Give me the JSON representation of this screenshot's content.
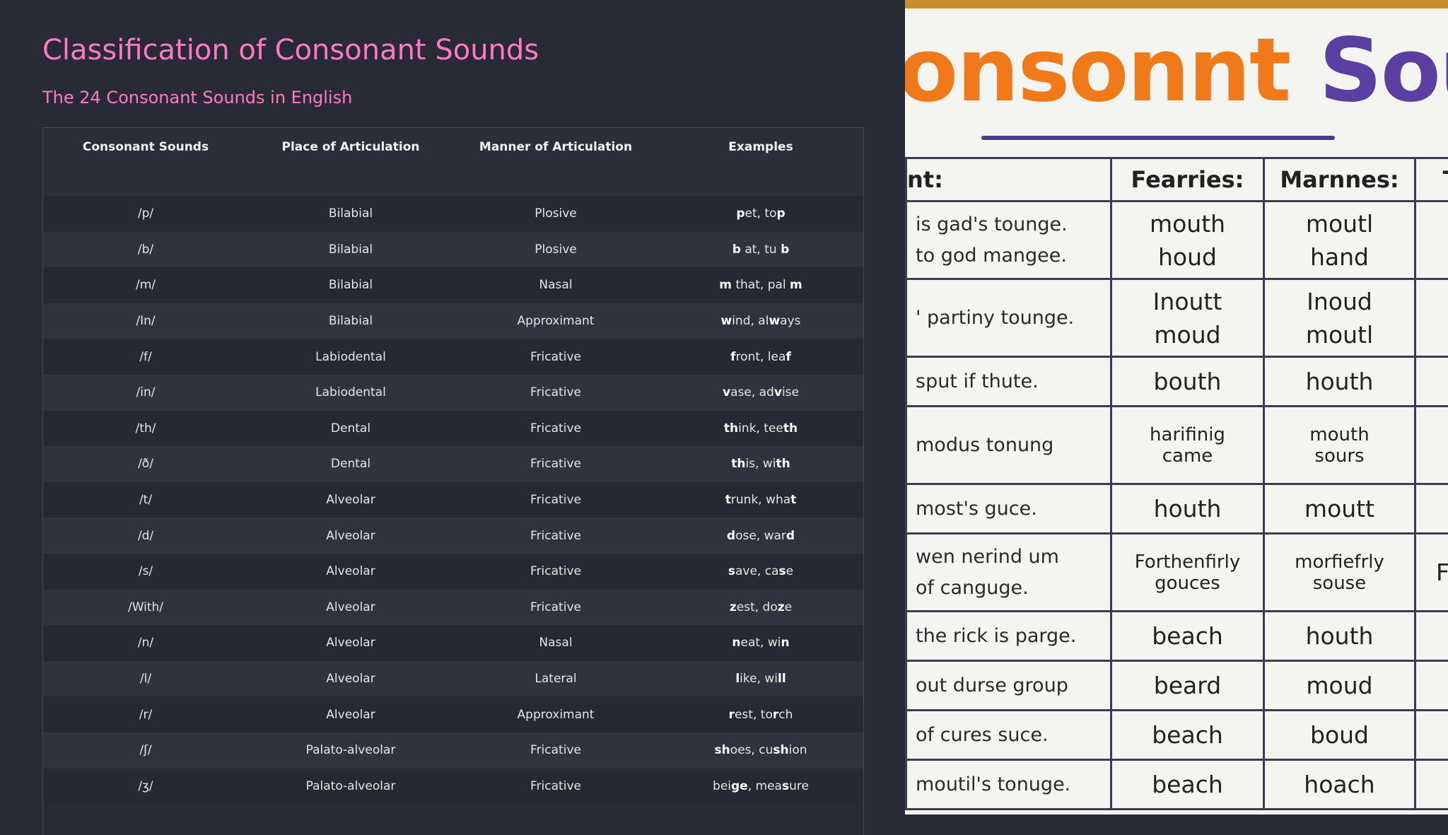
{
  "page": {
    "title": "Classification of Consonant Sounds",
    "subtitle": "The 24 Consonant Sounds in English"
  },
  "table": {
    "headers": [
      "Consonant Sounds",
      "Place of Articulation",
      "Manner of Articulation",
      "Examples"
    ],
    "rows": [
      {
        "sound": "/p/",
        "place": "Bilabial",
        "manner": "Plosive",
        "examples": [
          [
            "p",
            true
          ],
          [
            "et, to",
            false
          ],
          [
            "p",
            true
          ]
        ]
      },
      {
        "sound": "/b/",
        "place": "Bilabial",
        "manner": "Plosive",
        "examples": [
          [
            "b",
            true
          ],
          [
            " at, tu ",
            false
          ],
          [
            "b",
            true
          ]
        ]
      },
      {
        "sound": "/m/",
        "place": "Bilabial",
        "manner": "Nasal",
        "examples": [
          [
            "m",
            true
          ],
          [
            " that, pal ",
            false
          ],
          [
            "m",
            true
          ]
        ]
      },
      {
        "sound": "/In/",
        "place": "Bilabial",
        "manner": "Approximant",
        "examples": [
          [
            "w",
            true
          ],
          [
            "ind, al",
            false
          ],
          [
            "w",
            true
          ],
          [
            "ays",
            false
          ]
        ]
      },
      {
        "sound": "/f/",
        "place": "Labiodental",
        "manner": "Fricative",
        "examples": [
          [
            "f",
            true
          ],
          [
            "ront, lea",
            false
          ],
          [
            "f",
            true
          ]
        ]
      },
      {
        "sound": "/in/",
        "place": "Labiodental",
        "manner": "Fricative",
        "examples": [
          [
            "v",
            true
          ],
          [
            "ase, ad",
            false
          ],
          [
            "v",
            true
          ],
          [
            "ise",
            false
          ]
        ]
      },
      {
        "sound": "/th/",
        "place": "Dental",
        "manner": "Fricative",
        "examples": [
          [
            "th",
            true
          ],
          [
            "ink, tee",
            false
          ],
          [
            "th",
            true
          ]
        ]
      },
      {
        "sound": "/ð/",
        "place": "Dental",
        "manner": "Fricative",
        "examples": [
          [
            "th",
            true
          ],
          [
            "is, wi",
            false
          ],
          [
            "th",
            true
          ]
        ]
      },
      {
        "sound": "/t/",
        "place": "Alveolar",
        "manner": "Fricative",
        "examples": [
          [
            "t",
            true
          ],
          [
            "runk, wha",
            false
          ],
          [
            "t",
            true
          ]
        ]
      },
      {
        "sound": "/d/",
        "place": "Alveolar",
        "manner": "Fricative",
        "examples": [
          [
            "d",
            true
          ],
          [
            "ose, war",
            false
          ],
          [
            "d",
            true
          ]
        ]
      },
      {
        "sound": "/s/",
        "place": "Alveolar",
        "manner": "Fricative",
        "examples": [
          [
            "s",
            true
          ],
          [
            "ave, ca",
            false
          ],
          [
            "s",
            true
          ],
          [
            "e",
            false
          ]
        ]
      },
      {
        "sound": "/With/",
        "place": "Alveolar",
        "manner": "Fricative",
        "examples": [
          [
            "z",
            true
          ],
          [
            "est, do",
            false
          ],
          [
            "z",
            true
          ],
          [
            "e",
            false
          ]
        ]
      },
      {
        "sound": "/n/",
        "place": "Alveolar",
        "manner": "Nasal",
        "examples": [
          [
            "n",
            true
          ],
          [
            "eat, wi",
            false
          ],
          [
            "n",
            true
          ]
        ]
      },
      {
        "sound": "/l/",
        "place": "Alveolar",
        "manner": "Lateral",
        "examples": [
          [
            "l",
            true
          ],
          [
            "ike, wi",
            false
          ],
          [
            "ll",
            true
          ]
        ]
      },
      {
        "sound": "/r/",
        "place": "Alveolar",
        "manner": "Approximant",
        "examples": [
          [
            "r",
            true
          ],
          [
            "est, to",
            false
          ],
          [
            "r",
            true
          ],
          [
            "ch",
            false
          ]
        ]
      },
      {
        "sound": "/ʃ/",
        "place": "Palato-alveolar",
        "manner": "Fricative",
        "examples": [
          [
            "sh",
            true
          ],
          [
            "oes, cu",
            false
          ],
          [
            "sh",
            true
          ],
          [
            "ion",
            false
          ]
        ]
      },
      {
        "sound": "/ʒ/",
        "place": "Palato-alveolar",
        "manner": "Fricative",
        "examples": [
          [
            "bei",
            false
          ],
          [
            "ge",
            true
          ],
          [
            ", mea",
            false
          ],
          [
            "s",
            true
          ],
          [
            "ure",
            false
          ]
        ]
      }
    ]
  },
  "poster": {
    "heading_part1": "onsonnt",
    "heading_part2": "Sounc",
    "headers": [
      "nt:",
      "Fearries:",
      "Marnnes:",
      "T"
    ],
    "rows": [
      {
        "sentence": [
          "is gad's tounge.",
          "to god mangee."
        ],
        "col1": [
          "mouth",
          "houd"
        ],
        "col2": [
          "moutl",
          "hand"
        ],
        "small": false
      },
      {
        "sentence": [
          "' partiny tounge."
        ],
        "col1": [
          "Inoutt",
          "moud"
        ],
        "col2": [
          "Inoud",
          "moutl"
        ],
        "small": false
      },
      {
        "sentence": [
          "sput if thute."
        ],
        "col1": [
          "bouth"
        ],
        "col2": [
          "houth"
        ],
        "small": false
      },
      {
        "sentence": [
          "modus tonung"
        ],
        "col1": [
          "harifinig",
          "came"
        ],
        "col2": [
          "mouth",
          "sours"
        ],
        "small": true
      },
      {
        "sentence": [
          "most's guce."
        ],
        "col1": [
          "houth"
        ],
        "col2": [
          "moutt"
        ],
        "small": false
      },
      {
        "sentence": [
          "wen nerind um",
          "of canguge."
        ],
        "col1": [
          "Forthenfirly",
          "gouces"
        ],
        "col2": [
          "morfiefrly",
          "souse"
        ],
        "small": true,
        "extra": "Fc"
      },
      {
        "sentence": [
          "the rick is parge."
        ],
        "col1": [
          "beach"
        ],
        "col2": [
          "houth"
        ],
        "small": false
      },
      {
        "sentence": [
          "out durse group"
        ],
        "col1": [
          "beard"
        ],
        "col2": [
          "moud"
        ],
        "small": false
      },
      {
        "sentence": [
          "of cures suce."
        ],
        "col1": [
          "beach"
        ],
        "col2": [
          "boud"
        ],
        "small": false
      },
      {
        "sentence": [
          "moutil's tonuge."
        ],
        "col1": [
          "beach"
        ],
        "col2": [
          "hoach"
        ],
        "small": false
      }
    ]
  }
}
